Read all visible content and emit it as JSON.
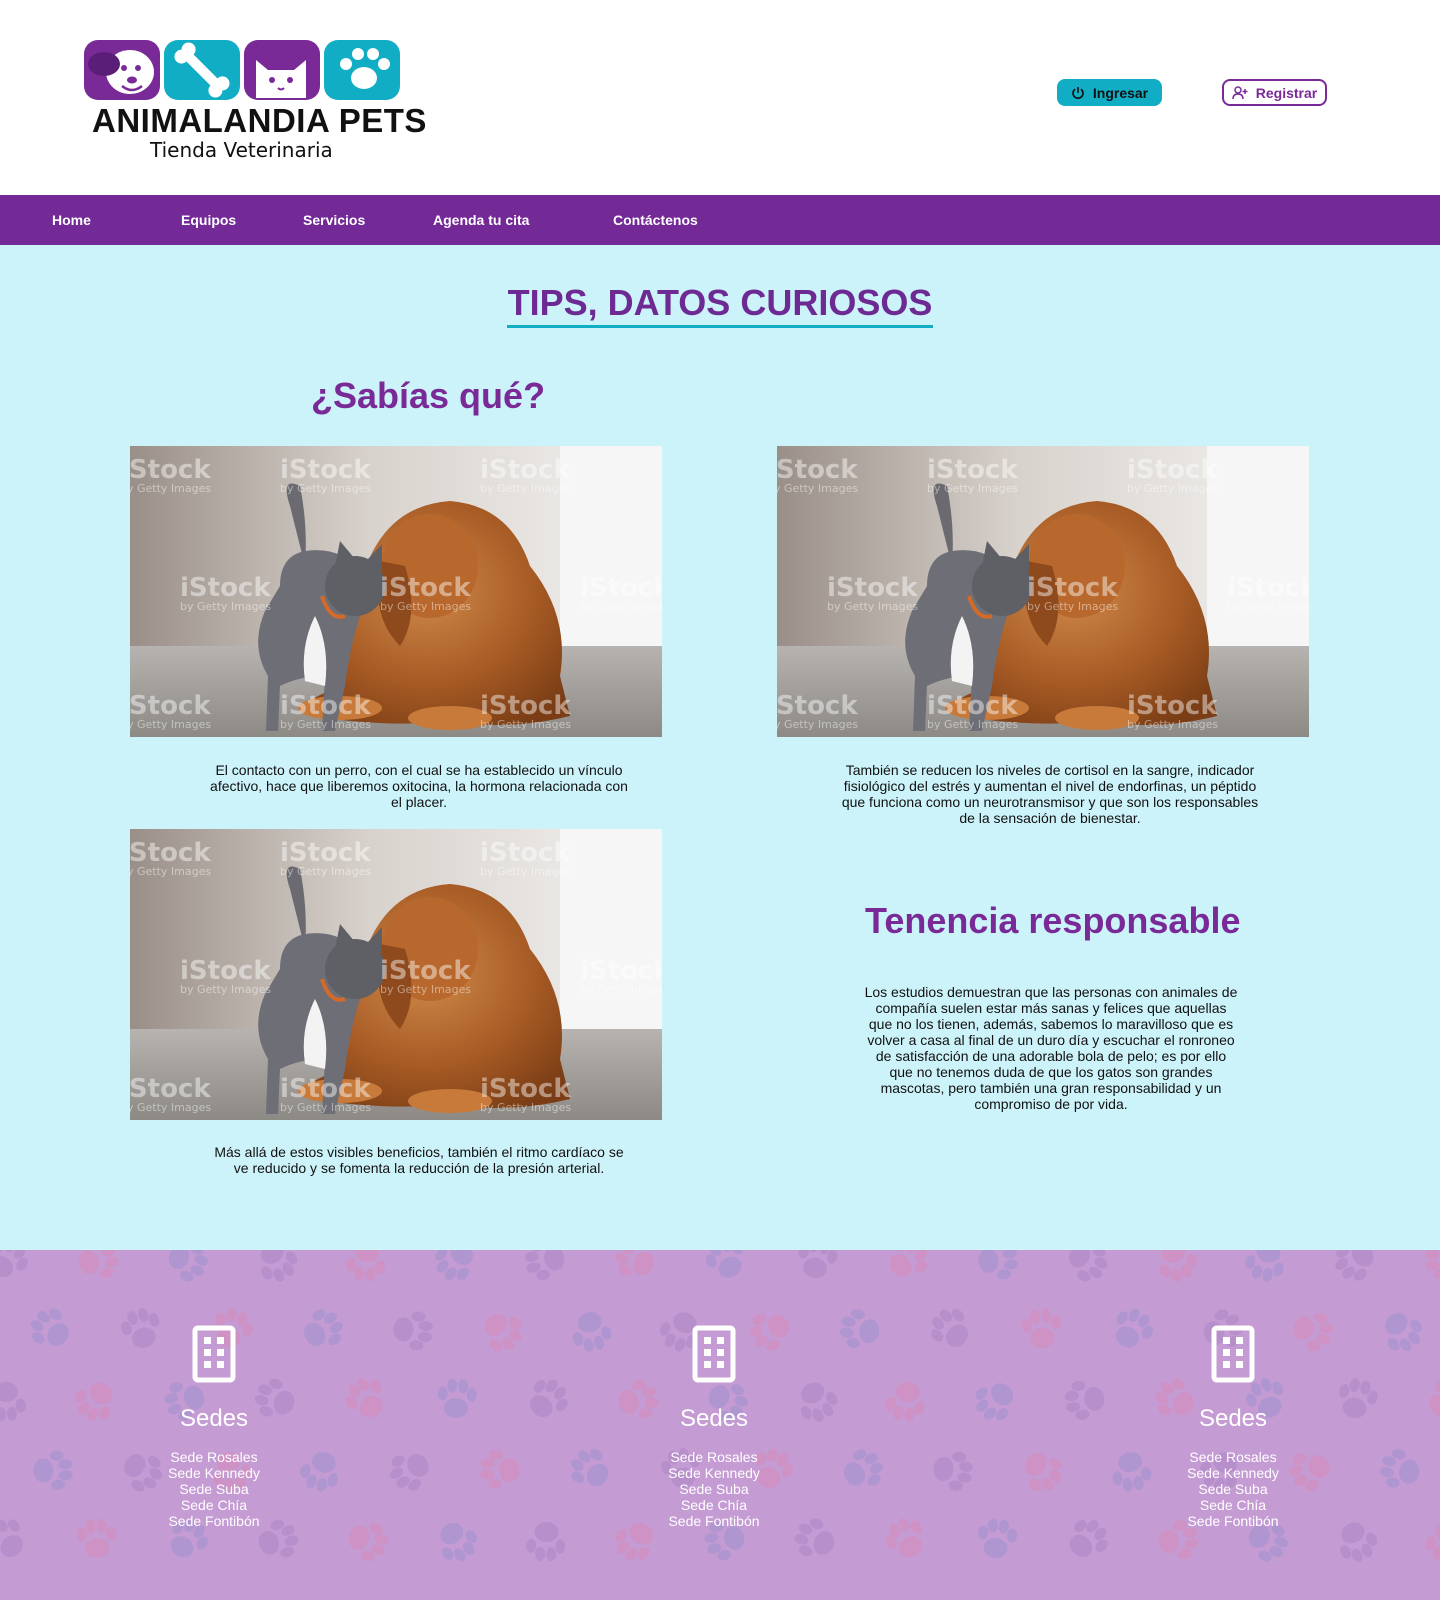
{
  "header": {
    "logo_title": "ANIMALANDIA PETS",
    "logo_subtitle": "Tienda Veterinaria",
    "login_label": "Ingresar",
    "register_label": "Registrar"
  },
  "nav": {
    "items": [
      "Home",
      "Equipos",
      "Servicios",
      "Agenda tu cita",
      "Contáctenos"
    ]
  },
  "main": {
    "title": "TIPS, DATOS CURIOSOS",
    "sabias_title": "¿Sabías qué?",
    "tenencia_title": "Tenencia responsable",
    "paragraphs": [
      "El contacto con un perro, con el cual se ha establecido un vínculo afectivo, hace que liberemos oxitocina, la hormona relacionada con el placer.",
      "También se reducen los niveles de cortisol en la sangre, indicador fisiológico del estrés y aumentan el nivel de endorfinas, un péptido que funciona como un neurotransmisor y que son los responsables de la sensación de bienestar.",
      "Más allá de estos visibles beneficios, también el ritmo cardíaco se ve reducido y se fomenta la reducción de la presión arterial.",
      "Los estudios demuestran que las personas con animales de compañía suelen estar más sanas y felices que aquellas que no los tienen, además, sabemos lo maravilloso que es volver a casa al final de un duro día y escuchar el ronroneo de satisfacción de una adorable bola de pelo; es por ello que no tenemos duda de que los gatos son grandes mascotas, pero también una gran responsabilidad y un compromiso de por vida."
    ],
    "photo_watermark": "iStock",
    "photo_watermark_sub": "by Getty Images"
  },
  "footer": {
    "columns": [
      {
        "title": "Sedes",
        "items": [
          "Sede Rosales",
          "Sede Kennedy",
          "Sede Suba",
          "Sede Chía",
          "Sede Fontibón"
        ]
      },
      {
        "title": "Sedes",
        "items": [
          "Sede Rosales",
          "Sede Kennedy",
          "Sede Suba",
          "Sede Chía",
          "Sede Fontibón"
        ]
      },
      {
        "title": "Sedes",
        "items": [
          "Sede Rosales",
          "Sede Kennedy",
          "Sede Suba",
          "Sede Chía",
          "Sede Fontibón"
        ]
      }
    ]
  },
  "colors": {
    "purple": "#732a96",
    "teal": "#10adc4",
    "main_bg": "#cdf3fa",
    "footer_bg": "#c49bd3"
  },
  "icons": [
    "power-icon",
    "add-user-icon",
    "building-icon",
    "dog-tile-icon",
    "bone-tile-icon",
    "cat-tile-icon",
    "paw-tile-icon"
  ]
}
